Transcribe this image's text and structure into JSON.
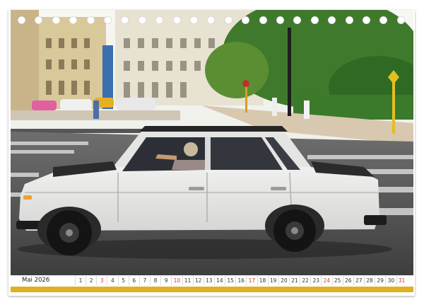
{
  "calendar": {
    "month_label": "Mai 2026",
    "days": [
      {
        "n": "1",
        "sun": false
      },
      {
        "n": "2",
        "sun": false
      },
      {
        "n": "3",
        "sun": true
      },
      {
        "n": "4",
        "sun": false
      },
      {
        "n": "5",
        "sun": false
      },
      {
        "n": "6",
        "sun": false
      },
      {
        "n": "7",
        "sun": false
      },
      {
        "n": "8",
        "sun": false
      },
      {
        "n": "9",
        "sun": false
      },
      {
        "n": "10",
        "sun": true
      },
      {
        "n": "11",
        "sun": false
      },
      {
        "n": "12",
        "sun": false
      },
      {
        "n": "13",
        "sun": false
      },
      {
        "n": "14",
        "sun": false
      },
      {
        "n": "15",
        "sun": false
      },
      {
        "n": "16",
        "sun": false
      },
      {
        "n": "17",
        "sun": true
      },
      {
        "n": "18",
        "sun": false
      },
      {
        "n": "19",
        "sun": false
      },
      {
        "n": "20",
        "sun": false
      },
      {
        "n": "21",
        "sun": false
      },
      {
        "n": "22",
        "sun": false
      },
      {
        "n": "23",
        "sun": false
      },
      {
        "n": "24",
        "sun": true
      },
      {
        "n": "25",
        "sun": false
      },
      {
        "n": "26",
        "sun": false
      },
      {
        "n": "27",
        "sun": false
      },
      {
        "n": "28",
        "sun": false
      },
      {
        "n": "29",
        "sun": false
      },
      {
        "n": "30",
        "sun": false
      },
      {
        "n": "31",
        "sun": true
      }
    ]
  },
  "colors": {
    "accent": "#e0b020",
    "sunday": "#d23a2a",
    "car_body": "#f2f2f0",
    "car_roof": "#2b2b2b"
  }
}
